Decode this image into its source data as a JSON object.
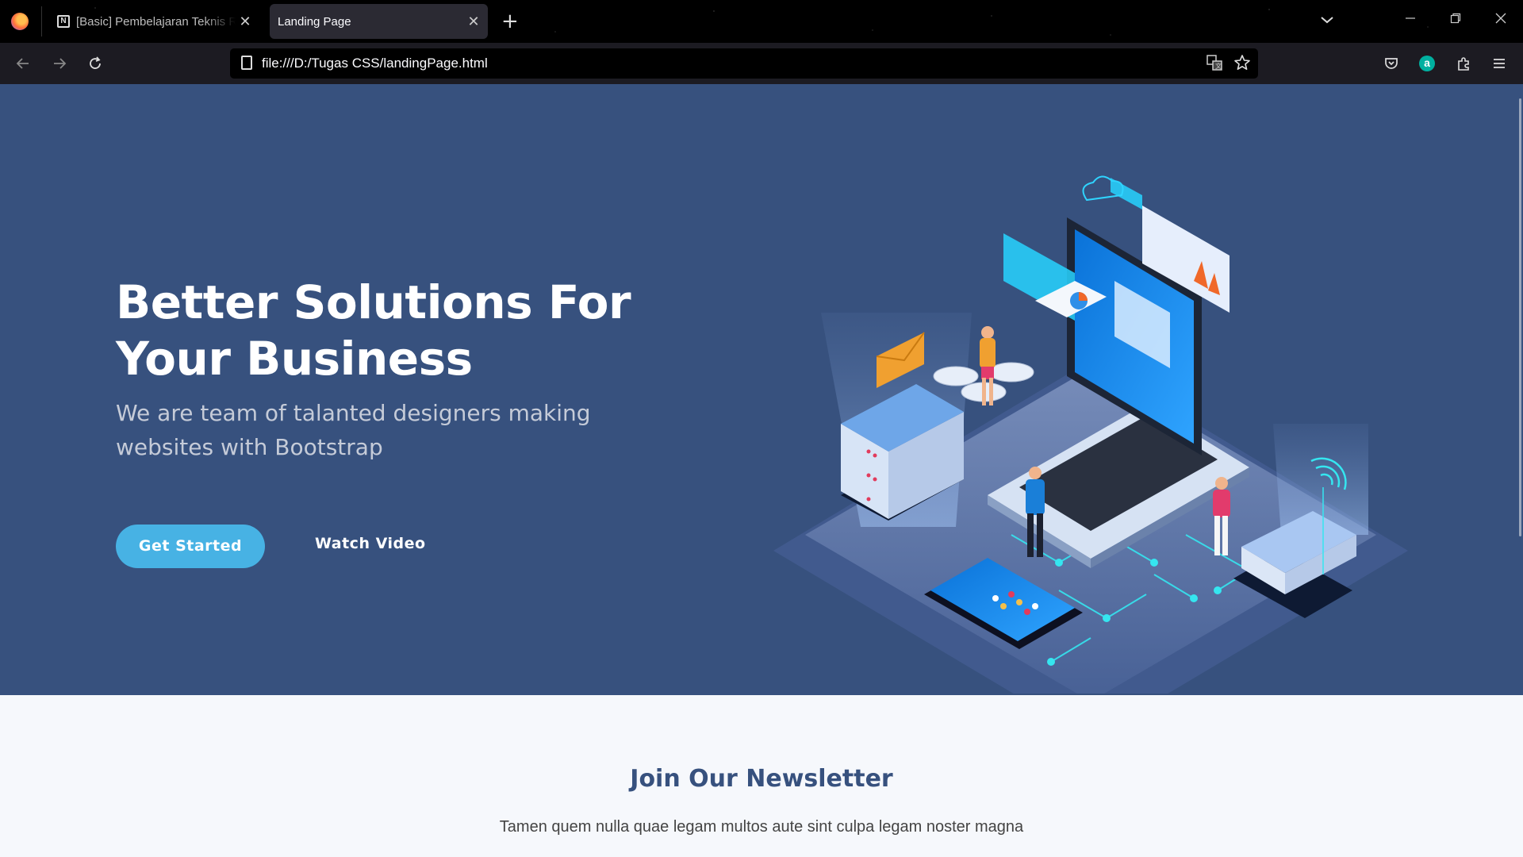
{
  "browser": {
    "tabs": [
      {
        "title": "[Basic] Pembelajaran Teknis Re",
        "favicon": "N",
        "active": false
      },
      {
        "title": "Landing Page",
        "active": true
      }
    ],
    "new_tab_symbol": "+",
    "url": "file:///D:/Tugas CSS/landingPage.html",
    "icons": {
      "tab_list": "chevron-down-icon",
      "minimize": "minimize-icon",
      "restore": "restore-icon",
      "close": "close-icon",
      "back": "back-arrow-icon",
      "forward": "forward-arrow-icon",
      "reload": "reload-icon",
      "translate": "translate-icon",
      "bookmark": "star-icon",
      "pocket": "pocket-icon",
      "account": "account-icon",
      "extensions": "puzzle-icon",
      "menu": "hamburger-menu-icon"
    },
    "account_letter": "a"
  },
  "hero": {
    "title": "Better Solutions For Your Business",
    "subtitle": "We are team of talanted designers making websites with Bootstrap",
    "primary_button": "Get Started",
    "secondary_button": "Watch Video",
    "background": "#37517e",
    "accent": "#47b2e4"
  },
  "newsletter": {
    "title": "Join Our Newsletter",
    "subtitle": "Tamen quem nulla quae legam multos aute sint culpa legam noster magna"
  }
}
